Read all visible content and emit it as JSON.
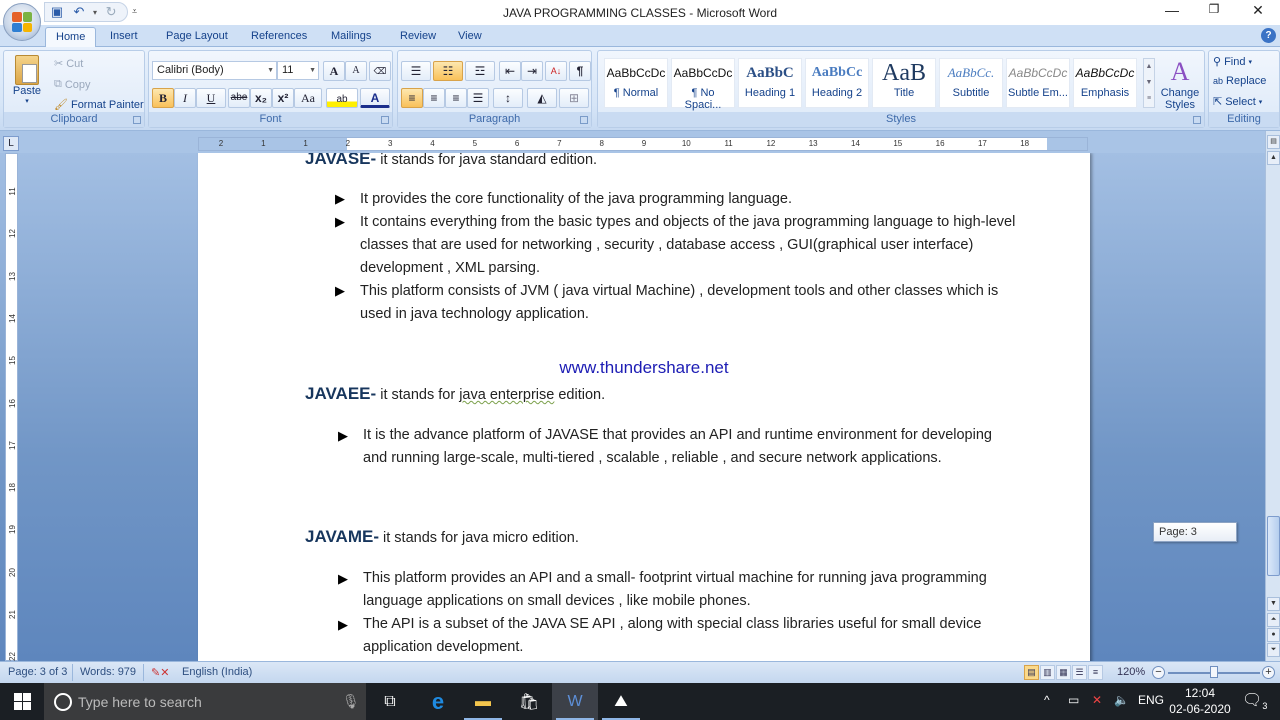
{
  "window": {
    "title": "JAVA PROGRAMMING  CLASSES - Microsoft Word",
    "minimize": "—",
    "restore": "❐",
    "close": "✕"
  },
  "qat": {
    "save_icon": "save-icon",
    "undo_icon": "undo-icon",
    "redo_icon": "redo-icon"
  },
  "tabs": [
    {
      "label": "Home",
      "active": true
    },
    {
      "label": "Insert"
    },
    {
      "label": "Page Layout"
    },
    {
      "label": "References"
    },
    {
      "label": "Mailings"
    },
    {
      "label": "Review"
    },
    {
      "label": "View"
    }
  ],
  "ribbon": {
    "clipboard": {
      "label": "Clipboard",
      "paste": "Paste",
      "cut": "Cut",
      "copy": "Copy",
      "format_painter": "Format Painter"
    },
    "font": {
      "label": "Font",
      "font_name": "Calibri (Body)",
      "font_size": "11",
      "bold": "B",
      "italic": "I",
      "underline": "U",
      "strikethrough": "abe",
      "subscript": "x₂",
      "superscript": "x²",
      "change_case": "Aa",
      "grow": "A",
      "shrink": "A"
    },
    "paragraph": {
      "label": "Paragraph",
      "sort": "A↓",
      "show_marks": "¶"
    },
    "styles": {
      "label": "Styles",
      "items": [
        {
          "preview": "AaBbCcDc",
          "name": "¶ Normal"
        },
        {
          "preview": "AaBbCcDc",
          "name": "¶ No Spaci..."
        },
        {
          "preview": "AaBbC",
          "name": "Heading 1"
        },
        {
          "preview": "AaBbCc",
          "name": "Heading 2"
        },
        {
          "preview": "AaB",
          "name": "Title"
        },
        {
          "preview": "AaBbCc.",
          "name": "Subtitle"
        },
        {
          "preview": "AaBbCcDc",
          "name": "Subtle Em..."
        },
        {
          "preview": "AaBbCcDc",
          "name": "Emphasis"
        }
      ],
      "change_styles": "Change Styles"
    },
    "editing": {
      "label": "Editing",
      "find": "Find",
      "replace": "Replace",
      "select": "Select"
    }
  },
  "ruler": {
    "h_ticks": [
      "2",
      "1",
      "1",
      "2",
      "3",
      "4",
      "5",
      "6",
      "7",
      "8",
      "9",
      "10",
      "11",
      "12",
      "13",
      "14",
      "15",
      "16",
      "17",
      "18"
    ],
    "v_ticks": [
      "11",
      "12",
      "13",
      "14",
      "15",
      "16",
      "17",
      "18",
      "19",
      "20",
      "21",
      "22"
    ]
  },
  "document": {
    "javase": {
      "heading": "JAVASE",
      "dash": "-",
      "text": " it stands for java standard edition.",
      "bullets": [
        [
          "It provides the core functionality of the java programming language."
        ],
        [
          "It contains everything from the basic types and objects of the java programming language to high-level",
          "classes  that are used  for networking , security , database access , GUI(graphical user interface)",
          "development , XML parsing."
        ],
        [
          "This platform consists of JVM ( java virtual Machine) , development tools  and other classes which is",
          "used in java technology application."
        ]
      ]
    },
    "watermark": "www.thundershare.net",
    "javaee": {
      "heading": "JAVAEE",
      "dash": "-",
      "text_a": " it stands for ",
      "text_sq": "java  enterprise",
      "text_b": " edition.",
      "bullets": [
        [
          "It is the advance platform of  JAVASE that provides an API and runtime environment for developing",
          "and running large-scale, multi-tiered , scalable , reliable , and secure network applications."
        ]
      ]
    },
    "javame": {
      "heading": "JAVAME",
      "dash": "-",
      "text": " it stands for java micro edition.",
      "bullets": [
        [
          "This platform provides an API and a small- footprint virtual machine for running java programming",
          "language applications on small devices , like mobile phones."
        ],
        [
          "The API is a subset of the JAVA SE  API , along with special class libraries useful for small device",
          "application development."
        ]
      ]
    },
    "page_tooltip": "Page: 3"
  },
  "status": {
    "page": "Page: 3 of 3",
    "words": "Words: 979",
    "language": "English (India)",
    "zoom": "120%"
  },
  "taskbar": {
    "search_placeholder": "Type here to search",
    "language": "ENG",
    "time": "12:04",
    "date": "02-06-2020",
    "notifications": "3"
  }
}
